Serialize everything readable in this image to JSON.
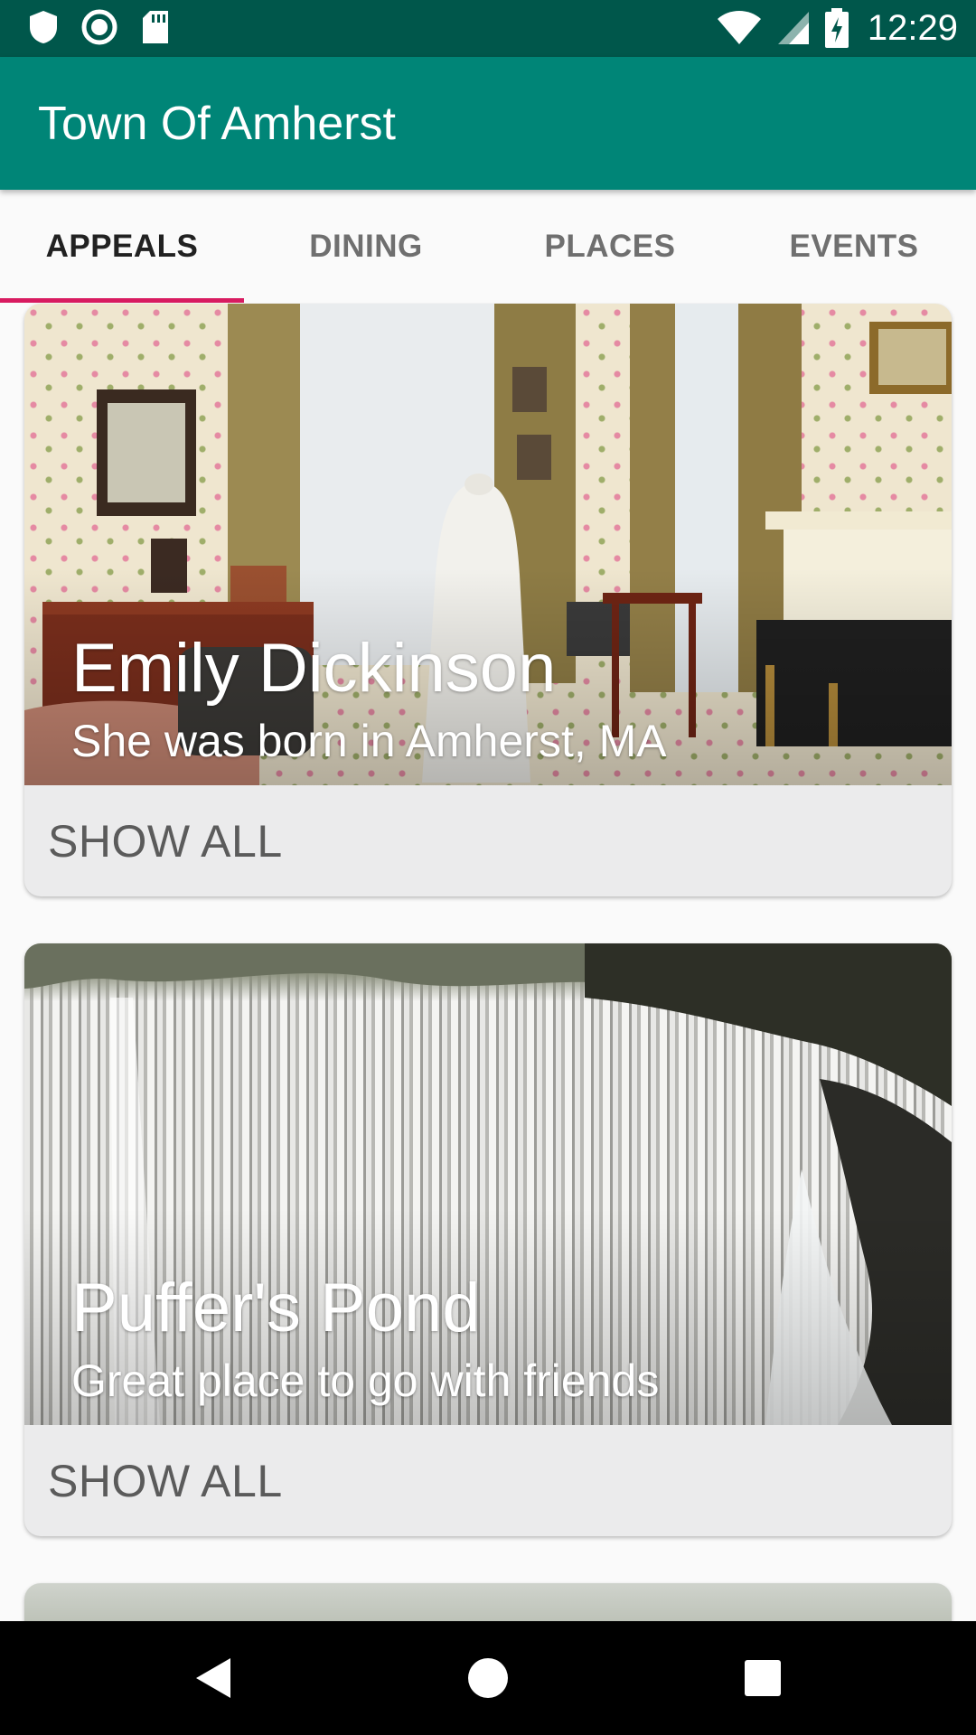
{
  "status_bar": {
    "time": "12:29",
    "left_icons": [
      "shield-icon",
      "circle-icon",
      "sd-card-icon"
    ],
    "right_icons": [
      "wifi-icon",
      "signal-icon",
      "battery-charging-icon"
    ]
  },
  "app_bar": {
    "title": "Town Of Amherst",
    "color": "#008577"
  },
  "tabs": [
    {
      "label": "APPEALS",
      "active": true
    },
    {
      "label": "DINING",
      "active": false
    },
    {
      "label": "PLACES",
      "active": false
    },
    {
      "label": "EVENTS",
      "active": false
    }
  ],
  "accent_color": "#d81b60",
  "cards": [
    {
      "title": "Emily Dickinson",
      "subtitle": "She was born in Amherst, MA",
      "action": "SHOW ALL"
    },
    {
      "title": "Puffer's Pond",
      "subtitle": "Great place to go with friends",
      "action": "SHOW ALL"
    }
  ],
  "nav_bar": {
    "buttons": [
      "back-icon",
      "home-icon",
      "recents-icon"
    ]
  }
}
